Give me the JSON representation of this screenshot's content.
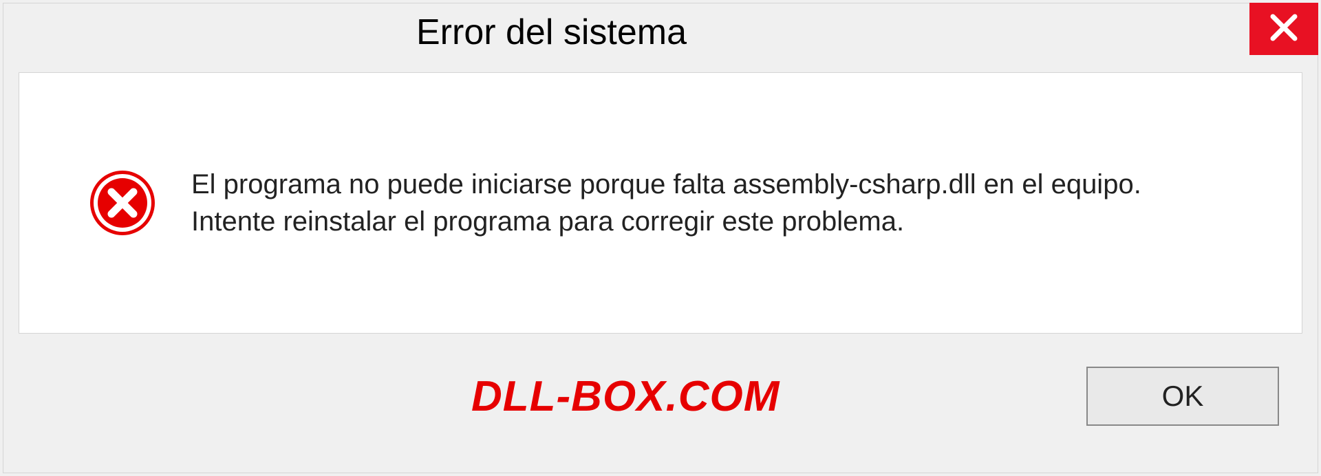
{
  "titlebar": {
    "title": "Error del sistema"
  },
  "content": {
    "message": "El programa no puede iniciarse porque falta assembly-csharp.dll en el equipo. Intente reinstalar el programa para corregir este problema."
  },
  "footer": {
    "watermark": "DLL-BOX.COM",
    "ok_label": "OK"
  },
  "colors": {
    "close_bg": "#e81123",
    "error_icon": "#e60000",
    "watermark": "#e60000"
  }
}
